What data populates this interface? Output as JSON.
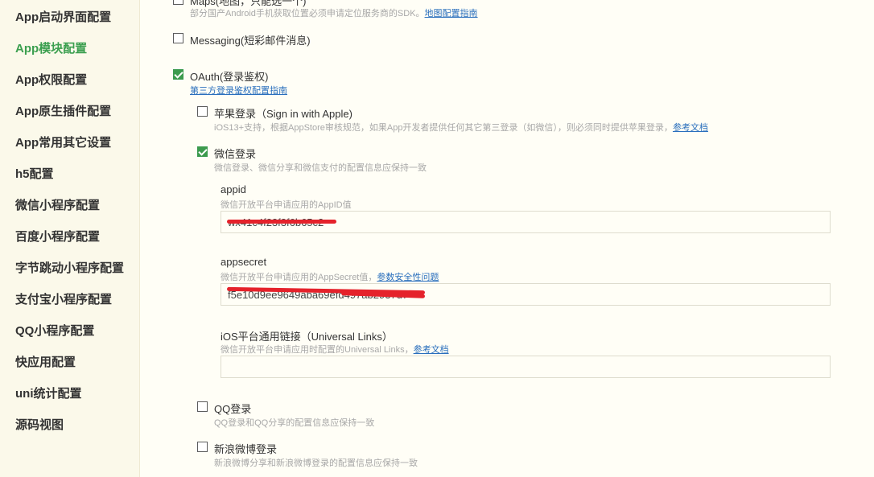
{
  "sidebar": {
    "items": [
      {
        "label": "App启动界面配置",
        "active": false
      },
      {
        "label": "App模块配置",
        "active": true
      },
      {
        "label": "App权限配置",
        "active": false
      },
      {
        "label": "App原生插件配置",
        "active": false
      },
      {
        "label": "App常用其它设置",
        "active": false
      },
      {
        "label": "h5配置",
        "active": false
      },
      {
        "label": "微信小程序配置",
        "active": false
      },
      {
        "label": "百度小程序配置",
        "active": false
      },
      {
        "label": "字节跳动小程序配置",
        "active": false
      },
      {
        "label": "支付宝小程序配置",
        "active": false
      },
      {
        "label": "QQ小程序配置",
        "active": false
      },
      {
        "label": "快应用配置",
        "active": false
      },
      {
        "label": "uni统计配置",
        "active": false
      },
      {
        "label": "源码视图",
        "active": false
      }
    ]
  },
  "modules": {
    "maps": {
      "label": "Maps(地图，只能选一个)",
      "hint": "部分国产Android手机获取位置必须申请定位服务商的SDK。",
      "link": "地图配置指南",
      "checked": false
    },
    "messaging": {
      "label": "Messaging(短彩邮件消息)",
      "checked": false
    },
    "oauth": {
      "label": "OAuth(登录鉴权)",
      "link": "第三方登录鉴权配置指南",
      "checked": true,
      "apple": {
        "label": "苹果登录（Sign in with Apple)",
        "hint": "iOS13+支持，根据AppStore审核规范，如果App开发者提供任何其它第三登录（如微信），则必须同时提供苹果登录，",
        "link": "参考文档",
        "checked": false
      },
      "weixin": {
        "label": "微信登录",
        "hint": "微信登录、微信分享和微信支付的配置信息应保持一致",
        "checked": true,
        "appid": {
          "label": "appid",
          "hint": "微信开放平台申请应用的AppID值",
          "value": "wx41c4f23f3f6b65c2"
        },
        "appsecret": {
          "label": "appsecret",
          "hint": "微信开放平台申请应用的AppSecret值，",
          "link": "参数安全性问题",
          "value": "f5e10d9ee9649aba69efd497ab2937d7"
        },
        "universal_links": {
          "label": "iOS平台通用链接（Universal Links）",
          "hint": "微信开放平台申请应用时配置的Universal Links，",
          "link": "参考文档",
          "value": ""
        }
      },
      "qq": {
        "label": "QQ登录",
        "hint": "QQ登录和QQ分享的配置信息应保持一致",
        "checked": false
      },
      "sina": {
        "label": "新浪微博登录",
        "hint": "新浪微博分享和新浪微博登录的配置信息应保持一致",
        "checked": false
      }
    }
  },
  "colors": {
    "accent_green": "#3b9f4f",
    "link_blue": "#2a6fbd",
    "redaction_red": "#e5222b",
    "background": "#fffef6"
  }
}
